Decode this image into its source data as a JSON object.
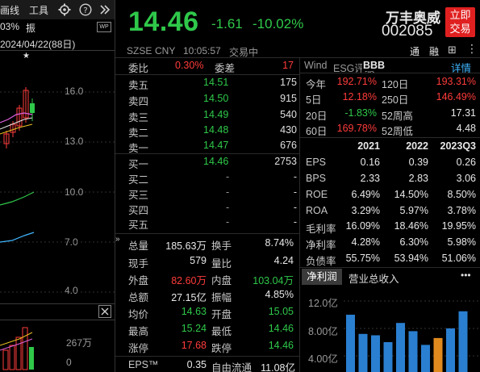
{
  "left_panel": {
    "toolbar": {
      "item1": "画线",
      "item2": "工具"
    },
    "pct": "03%",
    "zhen": "振",
    "date": "2024/04/22(88日)",
    "star": "★",
    "yticks": [
      "16.0",
      "13.0",
      "10.0",
      "7.0",
      "4.0"
    ],
    "vol_label": "267万",
    "vol_tick": "0"
  },
  "quote": {
    "price": "14.46",
    "change": "-1.61",
    "change_pct": "-10.02%",
    "name": "万丰奥威",
    "code": "002085",
    "trade_btn_line1": "立即",
    "trade_btn_line2": "交易",
    "exchange": "SZSE",
    "currency": "CNY",
    "time": "10:05:57",
    "status": "交易中",
    "tong": "通",
    "rong": "融"
  },
  "order_book": {
    "weibi_label": "委比",
    "weibi_value": "0.30%",
    "weicha_label": "委差",
    "weicha_value": "17",
    "asks": [
      {
        "label": "卖五",
        "price": "14.51",
        "vol": "175"
      },
      {
        "label": "卖四",
        "price": "14.50",
        "vol": "915"
      },
      {
        "label": "卖三",
        "price": "14.49",
        "vol": "540"
      },
      {
        "label": "卖二",
        "price": "14.48",
        "vol": "430"
      },
      {
        "label": "卖一",
        "price": "14.47",
        "vol": "676"
      }
    ],
    "bids": [
      {
        "label": "买一",
        "price": "14.46",
        "vol": "2753"
      },
      {
        "label": "买二",
        "price": "-",
        "vol": "-"
      },
      {
        "label": "买三",
        "price": "-",
        "vol": "-"
      },
      {
        "label": "买四",
        "price": "-",
        "vol": "-"
      },
      {
        "label": "买五",
        "price": "-",
        "vol": "-"
      }
    ]
  },
  "stats": [
    {
      "l1": "总量",
      "v1": "185.63万",
      "l2": "换手",
      "v2": "8.74%"
    },
    {
      "l1": "现手",
      "v1": "579",
      "l2": "量比",
      "v2": "4.24"
    },
    {
      "l1": "外盘",
      "v1": "82.60万",
      "l2": "内盘",
      "v2": "103.04万"
    },
    {
      "l1": "总额",
      "v1": "27.15亿",
      "l2": "振幅",
      "v2": "4.85%"
    },
    {
      "l1": "均价",
      "v1": "14.63",
      "l2": "开盘",
      "v2": "15.05"
    },
    {
      "l1": "最高",
      "v1": "15.24",
      "l2": "最低",
      "v2": "14.46"
    },
    {
      "l1": "涨停",
      "v1": "17.68",
      "l2": "跌停",
      "v2": "14.46"
    }
  ],
  "eps_row": {
    "l1": "EPS™",
    "v1": "0.35",
    "l2": "自由流通",
    "v2": "11.08亿"
  },
  "right_panel": {
    "wind_label": "Wind",
    "esg_label": "ESG评级",
    "esg_value": "BBB",
    "detail": "详情",
    "perf": [
      {
        "l1": "今年",
        "v1": "192.71%",
        "l2": "120日",
        "v2": "193.31%"
      },
      {
        "l1": "5日",
        "v1": "12.18%",
        "l2": "250日",
        "v2": "146.49%"
      },
      {
        "l1": "20日",
        "v1": "-1.83%",
        "l2": "52周高",
        "v2": "17.31"
      },
      {
        "l1": "60日",
        "v1": "169.78%",
        "l2": "52周低",
        "v2": "4.48"
      }
    ],
    "fin_headers": [
      "2021",
      "2022",
      "2023Q3"
    ],
    "fin": [
      {
        "label": "EPS",
        "values": [
          "0.16",
          "0.39",
          "0.26"
        ]
      },
      {
        "label": "BPS",
        "values": [
          "2.33",
          "2.83",
          "3.06"
        ]
      },
      {
        "label": "ROE",
        "values": [
          "6.49%",
          "14.50%",
          "8.50%"
        ]
      },
      {
        "label": "ROA",
        "values": [
          "3.29%",
          "5.97%",
          "3.78%"
        ]
      },
      {
        "label": "毛利率",
        "values": [
          "16.09%",
          "18.46%",
          "19.95%"
        ]
      },
      {
        "label": "净利率",
        "values": [
          "4.28%",
          "6.30%",
          "5.98%"
        ]
      },
      {
        "label": "负债率",
        "values": [
          "55.75%",
          "53.94%",
          "51.06%"
        ]
      }
    ],
    "tabs": [
      "净利润",
      "营业总收入"
    ],
    "more": "•••",
    "chart_yticks": [
      "12.0亿",
      "8.00亿",
      "4.00亿"
    ]
  },
  "colors": {
    "up": "#ff3b3b",
    "down": "#2fc84a",
    "accent": "#3fb6ff",
    "brand_btn": "#e02020"
  },
  "icons": {
    "settings": "gear-icon",
    "help": "help-icon",
    "expand": "chevron-right-double-icon",
    "screen": "wp-icon",
    "close": "close-icon"
  },
  "chart_data": {
    "type": "bar",
    "ylim": [
      0,
      13
    ],
    "values": [
      10.0,
      7.2,
      7.0,
      6.0,
      8.8,
      7.6,
      5.6,
      6.6,
      8.0,
      10.5
    ],
    "highlight_index": [
      7
    ]
  }
}
